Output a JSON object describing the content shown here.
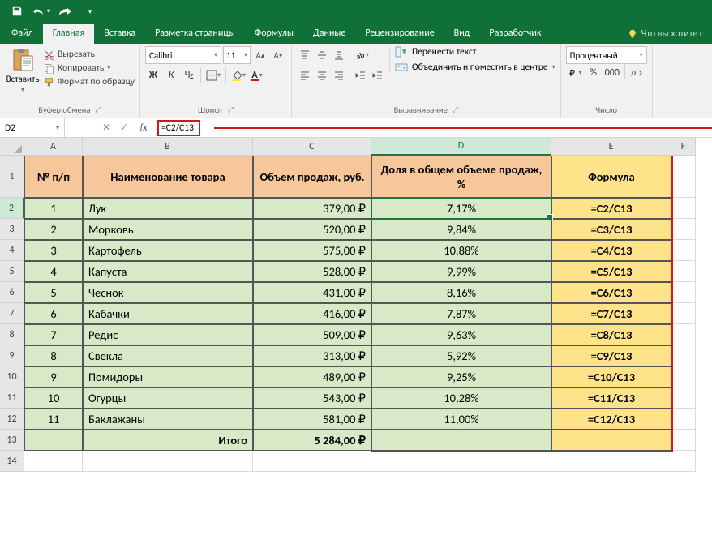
{
  "quickAccess": {
    "saveIcon": "save",
    "undoIcon": "undo",
    "redoIcon": "redo"
  },
  "tabs": {
    "file": "Файл",
    "home": "Главная",
    "insert": "Вставка",
    "layout": "Разметка страницы",
    "formulas": "Формулы",
    "data": "Данные",
    "review": "Рецензирование",
    "view": "Вид",
    "developer": "Разработчик",
    "tellMe": "Что вы хотите с"
  },
  "ribbon": {
    "paste": "Вставить",
    "cut": "Вырезать",
    "copy": "Копировать",
    "formatPainter": "Формат по образцу",
    "clipboard": "Буфер обмена",
    "fontName": "Calibri",
    "fontSize": "11",
    "fontGroup": "Шрифт",
    "wrapText": "Перенести текст",
    "mergeCenter": "Объединить и поместить в центре",
    "alignGroup": "Выравнивание",
    "numberFormat": "Процентный",
    "numberGroup": "Число",
    "bold": "Ж",
    "italic": "К",
    "underline": "Ч"
  },
  "nameBox": "D2",
  "formula": "=C2/C13",
  "headers": {
    "A": "№ п/п",
    "B": "Наименование товара",
    "C": "Объем продаж, руб.",
    "D": "Доля в общем объеме продаж, %",
    "E": "Формула"
  },
  "rows": [
    {
      "n": "1",
      "name": "Лук",
      "vol": "379,00 ₽",
      "pct": "7,17%",
      "f": "=C2/C13"
    },
    {
      "n": "2",
      "name": "Морковь",
      "vol": "520,00 ₽",
      "pct": "9,84%",
      "f": "=C3/C13"
    },
    {
      "n": "3",
      "name": "Картофель",
      "vol": "575,00 ₽",
      "pct": "10,88%",
      "f": "=C4/C13"
    },
    {
      "n": "4",
      "name": "Капуста",
      "vol": "528,00 ₽",
      "pct": "9,99%",
      "f": "=C5/C13"
    },
    {
      "n": "5",
      "name": "Чеснок",
      "vol": "431,00 ₽",
      "pct": "8,16%",
      "f": "=C6/C13"
    },
    {
      "n": "6",
      "name": "Кабачки",
      "vol": "416,00 ₽",
      "pct": "7,87%",
      "f": "=C7/C13"
    },
    {
      "n": "7",
      "name": "Редис",
      "vol": "509,00 ₽",
      "pct": "9,63%",
      "f": "=C8/C13"
    },
    {
      "n": "8",
      "name": "Свекла",
      "vol": "313,00 ₽",
      "pct": "5,92%",
      "f": "=C9/C13"
    },
    {
      "n": "9",
      "name": "Помидоры",
      "vol": "489,00 ₽",
      "pct": "9,25%",
      "f": "=C10/C13"
    },
    {
      "n": "10",
      "name": "Огурцы",
      "vol": "543,00 ₽",
      "pct": "10,28%",
      "f": "=C11/C13"
    },
    {
      "n": "11",
      "name": "Баклажаны",
      "vol": "581,00 ₽",
      "pct": "11,00%",
      "f": "=C12/C13"
    }
  ],
  "totalLabel": "Итого",
  "totalValue": "5 284,00 ₽",
  "cols": [
    "A",
    "B",
    "C",
    "D",
    "E",
    "F"
  ],
  "rowNums": [
    "1",
    "2",
    "3",
    "4",
    "5",
    "6",
    "7",
    "8",
    "9",
    "10",
    "11",
    "12",
    "13",
    "14"
  ]
}
